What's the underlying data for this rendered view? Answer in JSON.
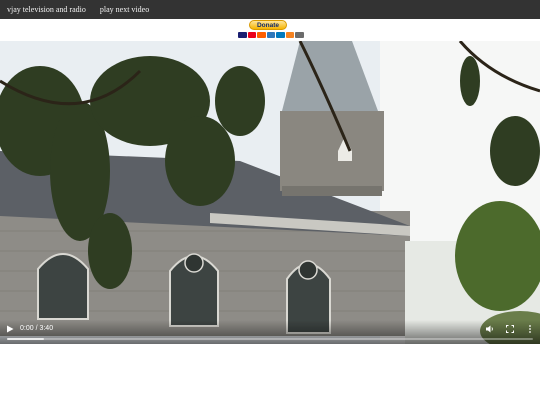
{
  "nav": {
    "link1": "vjay television and radio",
    "link2": "play next video"
  },
  "donate": {
    "label": "Donate",
    "cards": [
      "#1a1f71",
      "#eb001b",
      "#ff5f00",
      "#2e77bb",
      "#0079be",
      "#f58220",
      "#6b6b6b"
    ]
  },
  "player": {
    "time": "0:00 / 3:40",
    "buffered_fraction": 0.07
  },
  "colors": {
    "nav_bg": "#333333",
    "nav_text": "#f2f2f2",
    "player_bg": "#000000"
  }
}
